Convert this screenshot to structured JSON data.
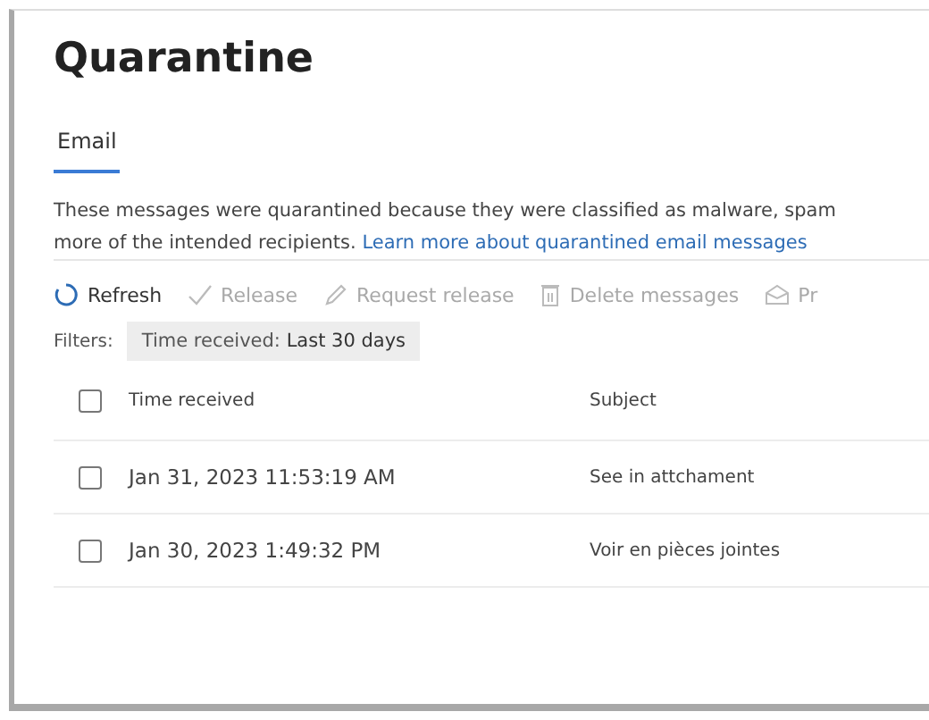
{
  "title": "Quarantine",
  "tabs": [
    {
      "label": "Email",
      "selected": true
    }
  ],
  "description": {
    "text": "These messages were quarantined because they were classified as malware, spam",
    "text_2": "more of the intended recipients.",
    "link": "Learn more about quarantined email messages"
  },
  "toolbar": [
    {
      "kind": "refresh",
      "label": "Refresh",
      "disabled": false
    },
    {
      "kind": "release",
      "label": "Release",
      "disabled": true
    },
    {
      "kind": "request",
      "label": "Request release",
      "disabled": true
    },
    {
      "kind": "delete",
      "label": "Delete messages",
      "disabled": true
    },
    {
      "kind": "preview",
      "label": "Pr",
      "disabled": true
    }
  ],
  "filters": {
    "label": "Filters:",
    "chip_name": "Time received:",
    "chip_value": "Last 30 days"
  },
  "table": {
    "header_checked": false,
    "columns": [
      "Time received",
      "Subject"
    ],
    "rows": [
      {
        "checked": false,
        "time": "Jan 31, 2023 11:53:19 AM",
        "subject": "See in attchament"
      },
      {
        "checked": false,
        "time": "Jan 30, 2023 1:49:32 PM",
        "subject": "Voir en pièces jointes"
      }
    ]
  }
}
